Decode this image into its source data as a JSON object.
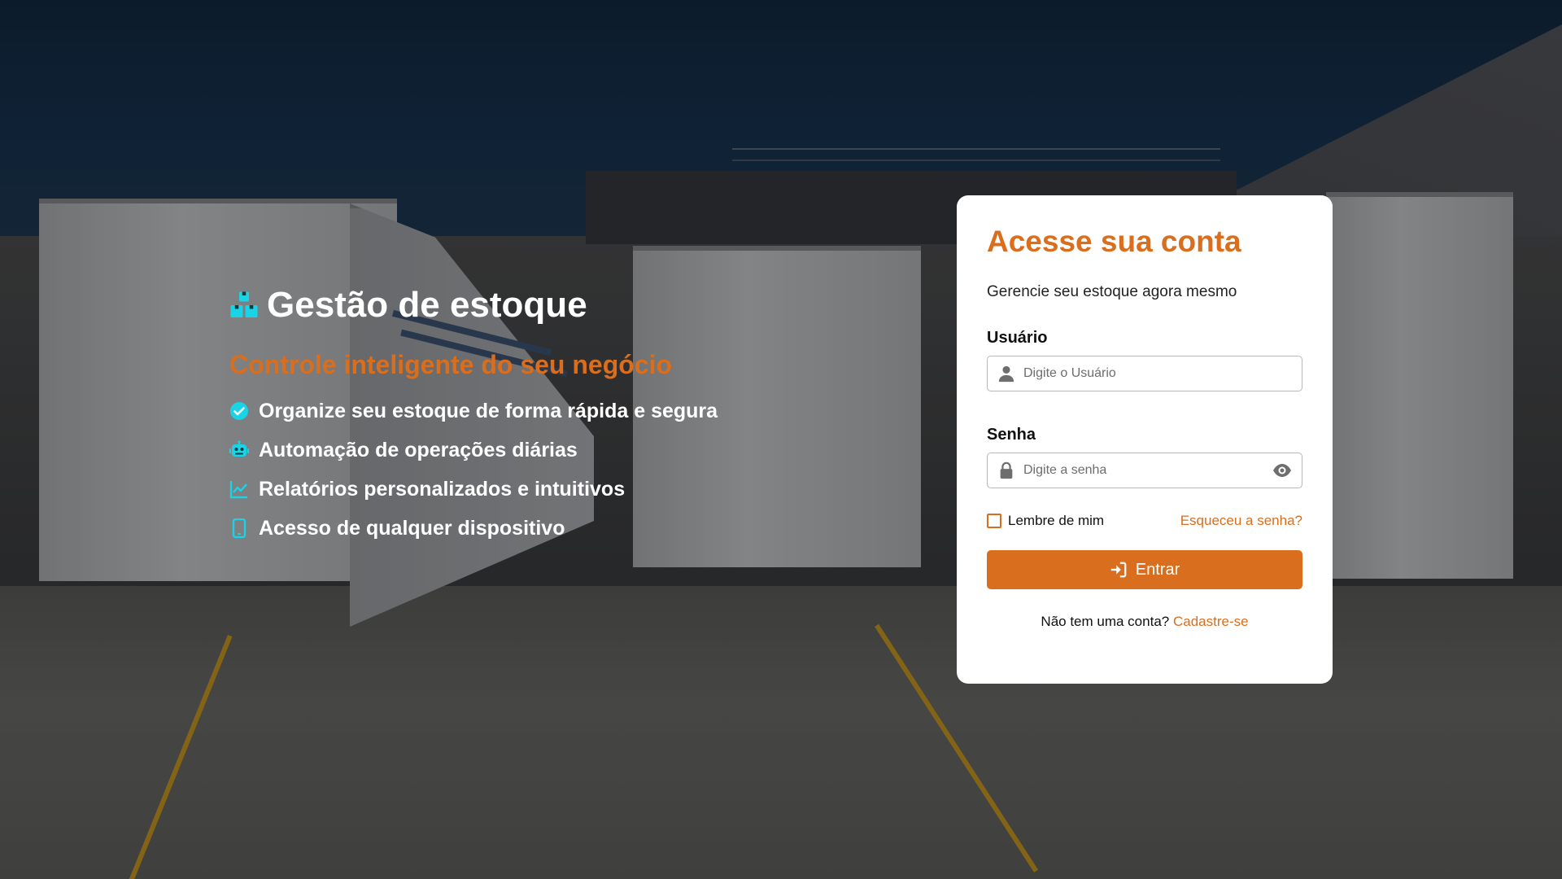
{
  "colors": {
    "accent": "#d96e1e",
    "feature_icon": "#19d3e6",
    "card_bg": "#ffffff"
  },
  "hero": {
    "icon": "boxes-icon",
    "title": "Gestão de estoque",
    "subtitle": "Controle inteligente do seu negócio",
    "features": [
      {
        "icon": "check-circle-icon",
        "label": "Organize seu estoque de forma rápida e segura"
      },
      {
        "icon": "robot-icon",
        "label": "Automação de operações diárias"
      },
      {
        "icon": "chart-line-icon",
        "label": "Relatórios personalizados e intuitivos"
      },
      {
        "icon": "mobile-icon",
        "label": "Acesso de qualquer dispositivo"
      }
    ]
  },
  "login": {
    "title": "Acesse sua conta",
    "subtitle": "Gerencie seu estoque agora mesmo",
    "username": {
      "label": "Usuário",
      "placeholder": "Digite o Usuário",
      "value": ""
    },
    "password": {
      "label": "Senha",
      "placeholder": "Digite a senha",
      "value": ""
    },
    "remember_label": "Lembre de mim",
    "remember_checked": false,
    "forgot_label": "Esqueceu a senha?",
    "submit_label": "Entrar",
    "signup_prompt": "Não tem uma conta?",
    "signup_link": "Cadastre-se"
  }
}
